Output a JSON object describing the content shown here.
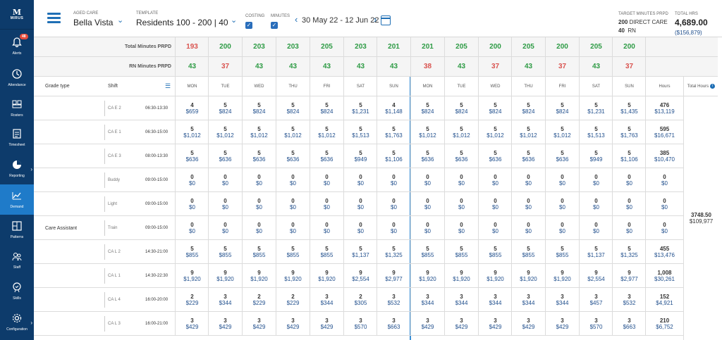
{
  "sidebar": {
    "logo_mark": "M",
    "logo_text": "MIRUS",
    "items": [
      {
        "label": "Alerts",
        "icon": "bell-icon",
        "badge": "48"
      },
      {
        "label": "Attendance",
        "icon": "clock-icon"
      },
      {
        "label": "Rosters",
        "icon": "roster-icon"
      },
      {
        "label": "Timesheet",
        "icon": "timesheet-icon"
      },
      {
        "label": "Reporting",
        "icon": "pie-chart-icon"
      },
      {
        "label": "Demand",
        "icon": "line-chart-icon"
      },
      {
        "label": "Patterns",
        "icon": "patterns-icon"
      },
      {
        "label": "Staff",
        "icon": "staff-icon"
      },
      {
        "label": "Skills",
        "icon": "skills-icon"
      },
      {
        "label": "Configuration",
        "icon": "gear-icon"
      }
    ]
  },
  "header": {
    "aged_care_label": "AGED CARE",
    "aged_care_value": "Bella Vista",
    "template_label": "TEMPLATE",
    "template_value": "Residents 100 - 200 | 40",
    "costing_label": "COSTING",
    "minutes_label": "MINUTES",
    "date_range": "30 May 22 - 12 Jun 22",
    "target_label": "TARGET MINUTES PRPD",
    "target_line1_num": "200",
    "target_line1_txt": "DIRECT CARE",
    "target_line2_num": "40",
    "target_line2_txt": "RN",
    "total_hrs_label": "TOTAL HRS",
    "total_hrs_value": "4,689.00",
    "total_cost": "($156,879)"
  },
  "summary": {
    "total_minutes_label": "Total Minutes PRPD",
    "total_minutes": [
      {
        "v": "193",
        "s": "red"
      },
      {
        "v": "200",
        "s": "green"
      },
      {
        "v": "203",
        "s": "green"
      },
      {
        "v": "203",
        "s": "green"
      },
      {
        "v": "205",
        "s": "green"
      },
      {
        "v": "203",
        "s": "green"
      },
      {
        "v": "201",
        "s": "green"
      },
      {
        "v": "201",
        "s": "green"
      },
      {
        "v": "205",
        "s": "green"
      },
      {
        "v": "200",
        "s": "green"
      },
      {
        "v": "205",
        "s": "green"
      },
      {
        "v": "200",
        "s": "green"
      },
      {
        "v": "205",
        "s": "green"
      },
      {
        "v": "200",
        "s": "green"
      }
    ],
    "rn_minutes_label": "RN Minutes PRPD",
    "rn_minutes": [
      {
        "v": "43",
        "s": "green"
      },
      {
        "v": "37",
        "s": "red"
      },
      {
        "v": "43",
        "s": "green"
      },
      {
        "v": "43",
        "s": "green"
      },
      {
        "v": "43",
        "s": "green"
      },
      {
        "v": "43",
        "s": "green"
      },
      {
        "v": "43",
        "s": "green"
      },
      {
        "v": "38",
        "s": "red"
      },
      {
        "v": "43",
        "s": "green"
      },
      {
        "v": "37",
        "s": "red"
      },
      {
        "v": "43",
        "s": "green"
      },
      {
        "v": "37",
        "s": "red"
      },
      {
        "v": "43",
        "s": "green"
      },
      {
        "v": "37",
        "s": "red"
      }
    ]
  },
  "columns": {
    "grade_type": "Grade type",
    "shift": "Shift",
    "days": [
      "MON",
      "TUE",
      "WED",
      "THU",
      "FRI",
      "SAT",
      "SUN",
      "MON",
      "TUE",
      "WED",
      "THU",
      "FRI",
      "SAT",
      "SUN"
    ],
    "hours": "Hours",
    "total_hours": "Total Hours"
  },
  "grade": {
    "name": "Care Assistant",
    "total_hours": "3748.50",
    "total_cost": "$109,977"
  },
  "shifts": [
    {
      "name": "CA E 2",
      "time": "06:30-13:30",
      "cells": [
        [
          "4",
          "$659"
        ],
        [
          "5",
          "$824"
        ],
        [
          "5",
          "$824"
        ],
        [
          "5",
          "$824"
        ],
        [
          "5",
          "$824"
        ],
        [
          "5",
          "$1,231"
        ],
        [
          "4",
          "$1,148"
        ],
        [
          "5",
          "$824"
        ],
        [
          "5",
          "$824"
        ],
        [
          "5",
          "$824"
        ],
        [
          "5",
          "$824"
        ],
        [
          "5",
          "$824"
        ],
        [
          "5",
          "$1,231"
        ],
        [
          "5",
          "$1,435"
        ]
      ],
      "hours": "476",
      "cost": "$13,119"
    },
    {
      "name": "CA E 1",
      "time": "06:30-15:00",
      "cells": [
        [
          "5",
          "$1,012"
        ],
        [
          "5",
          "$1,012"
        ],
        [
          "5",
          "$1,012"
        ],
        [
          "5",
          "$1,012"
        ],
        [
          "5",
          "$1,012"
        ],
        [
          "5",
          "$1,513"
        ],
        [
          "5",
          "$1,763"
        ],
        [
          "5",
          "$1,012"
        ],
        [
          "5",
          "$1,012"
        ],
        [
          "5",
          "$1,012"
        ],
        [
          "5",
          "$1,012"
        ],
        [
          "5",
          "$1,012"
        ],
        [
          "5",
          "$1,513"
        ],
        [
          "5",
          "$1,763"
        ]
      ],
      "hours": "595",
      "cost": "$16,671"
    },
    {
      "name": "CA E 3",
      "time": "08:00-13:30",
      "cells": [
        [
          "5",
          "$636"
        ],
        [
          "5",
          "$636"
        ],
        [
          "5",
          "$636"
        ],
        [
          "5",
          "$636"
        ],
        [
          "5",
          "$636"
        ],
        [
          "5",
          "$949"
        ],
        [
          "5",
          "$1,106"
        ],
        [
          "5",
          "$636"
        ],
        [
          "5",
          "$636"
        ],
        [
          "5",
          "$636"
        ],
        [
          "5",
          "$636"
        ],
        [
          "5",
          "$636"
        ],
        [
          "5",
          "$949"
        ],
        [
          "5",
          "$1,106"
        ]
      ],
      "hours": "385",
      "cost": "$10,470"
    },
    {
      "name": "Buddy",
      "time": "09:00-15:00",
      "cells": [
        [
          "0",
          "$0"
        ],
        [
          "0",
          "$0"
        ],
        [
          "0",
          "$0"
        ],
        [
          "0",
          "$0"
        ],
        [
          "0",
          "$0"
        ],
        [
          "0",
          "$0"
        ],
        [
          "0",
          "$0"
        ],
        [
          "0",
          "$0"
        ],
        [
          "0",
          "$0"
        ],
        [
          "0",
          "$0"
        ],
        [
          "0",
          "$0"
        ],
        [
          "0",
          "$0"
        ],
        [
          "0",
          "$0"
        ],
        [
          "0",
          "$0"
        ]
      ],
      "hours": "0",
      "cost": "$0"
    },
    {
      "name": "Light",
      "time": "09:00-15:00",
      "cells": [
        [
          "0",
          "$0"
        ],
        [
          "0",
          "$0"
        ],
        [
          "0",
          "$0"
        ],
        [
          "0",
          "$0"
        ],
        [
          "0",
          "$0"
        ],
        [
          "0",
          "$0"
        ],
        [
          "0",
          "$0"
        ],
        [
          "0",
          "$0"
        ],
        [
          "0",
          "$0"
        ],
        [
          "0",
          "$0"
        ],
        [
          "0",
          "$0"
        ],
        [
          "0",
          "$0"
        ],
        [
          "0",
          "$0"
        ],
        [
          "0",
          "$0"
        ]
      ],
      "hours": "0",
      "cost": "$0"
    },
    {
      "name": "Train",
      "time": "09:00-15:00",
      "cells": [
        [
          "0",
          "$0"
        ],
        [
          "0",
          "$0"
        ],
        [
          "0",
          "$0"
        ],
        [
          "0",
          "$0"
        ],
        [
          "0",
          "$0"
        ],
        [
          "0",
          "$0"
        ],
        [
          "0",
          "$0"
        ],
        [
          "0",
          "$0"
        ],
        [
          "0",
          "$0"
        ],
        [
          "0",
          "$0"
        ],
        [
          "0",
          "$0"
        ],
        [
          "0",
          "$0"
        ],
        [
          "0",
          "$0"
        ],
        [
          "0",
          "$0"
        ]
      ],
      "hours": "0",
      "cost": "$0"
    },
    {
      "name": "CA L 2",
      "time": "14:30-21:00",
      "cells": [
        [
          "5",
          "$855"
        ],
        [
          "5",
          "$855"
        ],
        [
          "5",
          "$855"
        ],
        [
          "5",
          "$855"
        ],
        [
          "5",
          "$855"
        ],
        [
          "5",
          "$1,137"
        ],
        [
          "5",
          "$1,325"
        ],
        [
          "5",
          "$855"
        ],
        [
          "5",
          "$855"
        ],
        [
          "5",
          "$855"
        ],
        [
          "5",
          "$855"
        ],
        [
          "5",
          "$855"
        ],
        [
          "5",
          "$1,137"
        ],
        [
          "5",
          "$1,325"
        ]
      ],
      "hours": "455",
      "cost": "$13,476"
    },
    {
      "name": "CA L 1",
      "time": "14:30-22:30",
      "cells": [
        [
          "9",
          "$1,920"
        ],
        [
          "9",
          "$1,920"
        ],
        [
          "9",
          "$1,920"
        ],
        [
          "9",
          "$1,920"
        ],
        [
          "9",
          "$1,920"
        ],
        [
          "9",
          "$2,554"
        ],
        [
          "9",
          "$2,977"
        ],
        [
          "9",
          "$1,920"
        ],
        [
          "9",
          "$1,920"
        ],
        [
          "9",
          "$1,920"
        ],
        [
          "9",
          "$1,920"
        ],
        [
          "9",
          "$1,920"
        ],
        [
          "9",
          "$2,554"
        ],
        [
          "9",
          "$2,977"
        ]
      ],
      "hours": "1,008",
      "cost": "$30,261"
    },
    {
      "name": "CA L 4",
      "time": "16:00-20:00",
      "cells": [
        [
          "2",
          "$229"
        ],
        [
          "3",
          "$344"
        ],
        [
          "2",
          "$229"
        ],
        [
          "2",
          "$229"
        ],
        [
          "3",
          "$344"
        ],
        [
          "2",
          "$305"
        ],
        [
          "3",
          "$532"
        ],
        [
          "3",
          "$344"
        ],
        [
          "3",
          "$344"
        ],
        [
          "3",
          "$344"
        ],
        [
          "3",
          "$344"
        ],
        [
          "3",
          "$344"
        ],
        [
          "3",
          "$457"
        ],
        [
          "3",
          "$532"
        ]
      ],
      "hours": "152",
      "cost": "$4,921"
    },
    {
      "name": "CA L 3",
      "time": "16:00-21:00",
      "cells": [
        [
          "3",
          "$429"
        ],
        [
          "3",
          "$429"
        ],
        [
          "3",
          "$429"
        ],
        [
          "3",
          "$429"
        ],
        [
          "3",
          "$429"
        ],
        [
          "3",
          "$570"
        ],
        [
          "3",
          "$663"
        ],
        [
          "3",
          "$429"
        ],
        [
          "3",
          "$429"
        ],
        [
          "3",
          "$429"
        ],
        [
          "3",
          "$429"
        ],
        [
          "3",
          "$429"
        ],
        [
          "3",
          "$570"
        ],
        [
          "3",
          "$663"
        ]
      ],
      "hours": "210",
      "cost": "$6,752"
    }
  ]
}
